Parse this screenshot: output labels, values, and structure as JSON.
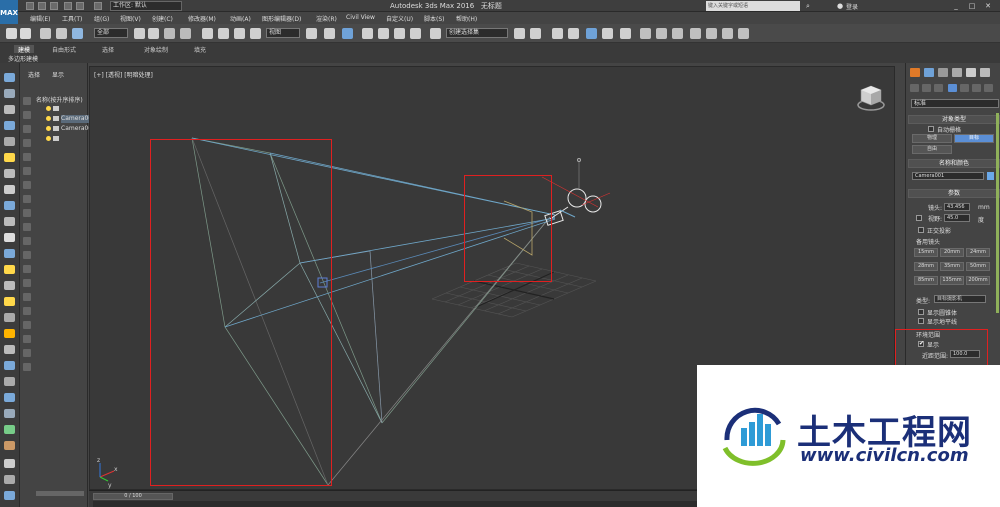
{
  "titlebar": {
    "workspace": "工作区: 默认",
    "title": "Autodesk 3ds Max 2016",
    "doc": "无标题",
    "search_placeholder": "键入关键字或短语",
    "login": "登录",
    "app_logo": "MAX"
  },
  "menu": [
    "编辑(E)",
    "工具(T)",
    "组(G)",
    "视图(V)",
    "创建(C)",
    "修改器(M)",
    "动画(A)",
    "图形编辑器(D)",
    "渲染(R)",
    "Civil View",
    "自定义(U)",
    "脚本(S)",
    "帮助(H)"
  ],
  "toolbar": {
    "filter_select": "全部",
    "view_select": "视图",
    "selection_set": "创建选择集"
  },
  "ribbon": {
    "tabs": [
      "建模",
      "自由形式",
      "选择",
      "对象绘制",
      "填充"
    ],
    "active_tab": "建模",
    "sub_label": "多边形建模"
  },
  "explorer": {
    "tabs": [
      "选择",
      "显示"
    ],
    "header": "名称(按升序排序)",
    "rows": [
      {
        "label": "Camera001",
        "selected": true
      },
      {
        "label": "Camera001.Target",
        "selected": false
      }
    ]
  },
  "viewport": {
    "label": "[+] [透视] [明暗处理]",
    "axis_labels": [
      "x",
      "y",
      "z"
    ]
  },
  "timeline": {
    "slider": "0 / 100"
  },
  "command_panel": {
    "category": "标准",
    "object_type": {
      "header": "对象类型",
      "autogrid": "自动栅格",
      "buttons": [
        "物理",
        "目标",
        "自由"
      ],
      "active": "目标"
    },
    "name_color": {
      "header": "名称和颜色",
      "name": "Camera001",
      "color": "#6aa9e9"
    },
    "params": {
      "header": "参数",
      "lens_label": "镜头:",
      "lens_value": "43.456",
      "lens_unit": "mm",
      "fov_label": "视野:",
      "fov_value": "45.0",
      "fov_unit": "度",
      "ortho": "正交投影",
      "stock_lens": "备用镜头",
      "lenses": [
        "15mm",
        "20mm",
        "24mm",
        "28mm",
        "35mm",
        "50mm",
        "85mm",
        "135mm",
        "200mm"
      ],
      "type_label": "类型:",
      "type_value": "目标摄影机",
      "show_cone": "显示圆锥体",
      "show_horizon": "显示地平线",
      "env_range": "环境范围",
      "show": "显示",
      "near_label": "近距范围:",
      "near_value": "100.0"
    }
  },
  "watermark": {
    "title": "土木工程网",
    "url": "www.civilcn.com"
  }
}
